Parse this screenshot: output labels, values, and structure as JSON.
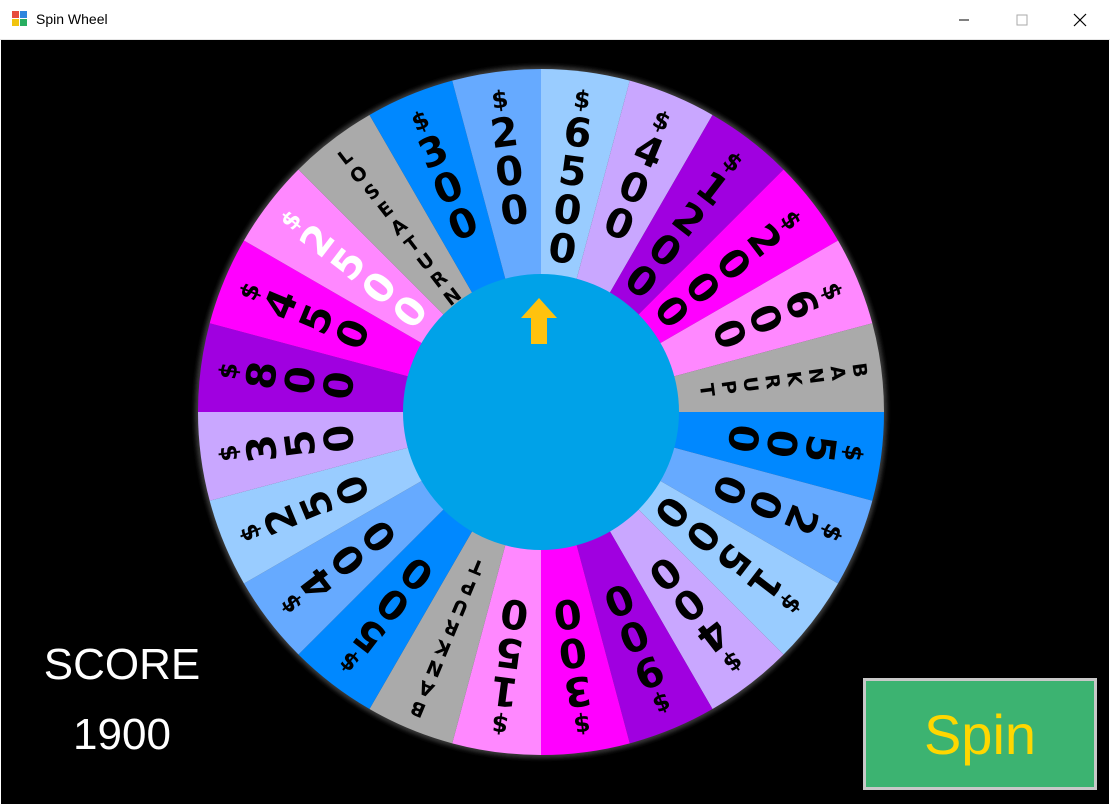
{
  "window": {
    "title": "Spin Wheel",
    "app_icon": "windows-form-icon",
    "controls": {
      "minimize": "minimize-icon",
      "maximize": "maximize-icon",
      "close": "close-icon"
    }
  },
  "wheel": {
    "center_color": "#00a2e8",
    "pointer_color": "#ffc20e",
    "pointer_icon": "arrow-up-icon",
    "segments": [
      {
        "text": "$6500",
        "color": "#99ccff",
        "text_color": "#000000"
      },
      {
        "text": "$400",
        "color": "#c9a7ff",
        "text_color": "#000000"
      },
      {
        "text": "$1200",
        "color": "#a000e0",
        "text_color": "#000000"
      },
      {
        "text": "$2000",
        "color": "#ff00ff",
        "text_color": "#000000"
      },
      {
        "text": "$600",
        "color": "#ff88ff",
        "text_color": "#000000"
      },
      {
        "text": "BANKRUPT",
        "color": "#aaaaaa",
        "text_color": "#000000"
      },
      {
        "text": "$500",
        "color": "#0088ff",
        "text_color": "#000000"
      },
      {
        "text": "$200",
        "color": "#66aaff",
        "text_color": "#000000"
      },
      {
        "text": "$1500",
        "color": "#99ccff",
        "text_color": "#000000"
      },
      {
        "text": "$400",
        "color": "#c9a7ff",
        "text_color": "#000000"
      },
      {
        "text": "$900",
        "color": "#a000e0",
        "text_color": "#000000"
      },
      {
        "text": "$300",
        "color": "#ff00ff",
        "text_color": "#000000"
      },
      {
        "text": "$150",
        "color": "#ff88ff",
        "text_color": "#000000"
      },
      {
        "text": "BANKRUPT",
        "color": "#aaaaaa",
        "text_color": "#000000"
      },
      {
        "text": "$500",
        "color": "#0088ff",
        "text_color": "#000000"
      },
      {
        "text": "$400",
        "color": "#66aaff",
        "text_color": "#000000"
      },
      {
        "text": "$250",
        "color": "#99ccff",
        "text_color": "#000000"
      },
      {
        "text": "$350",
        "color": "#c9a7ff",
        "text_color": "#000000"
      },
      {
        "text": "$800",
        "color": "#a000e0",
        "text_color": "#000000"
      },
      {
        "text": "$450",
        "color": "#ff00ff",
        "text_color": "#000000"
      },
      {
        "text": "$2500",
        "color": "#ff88ff",
        "text_color": "#ffffff"
      },
      {
        "text": "LOSE A TURN",
        "color": "#aaaaaa",
        "text_color": "#000000"
      },
      {
        "text": "$300",
        "color": "#0088ff",
        "text_color": "#000000"
      },
      {
        "text": "$200",
        "color": "#66aaff",
        "text_color": "#000000"
      }
    ]
  },
  "score": {
    "label": "SCORE",
    "value": "1900"
  },
  "spin_button": {
    "label": "Spin",
    "color": "#3cb371",
    "text_color": "#ffd700"
  }
}
